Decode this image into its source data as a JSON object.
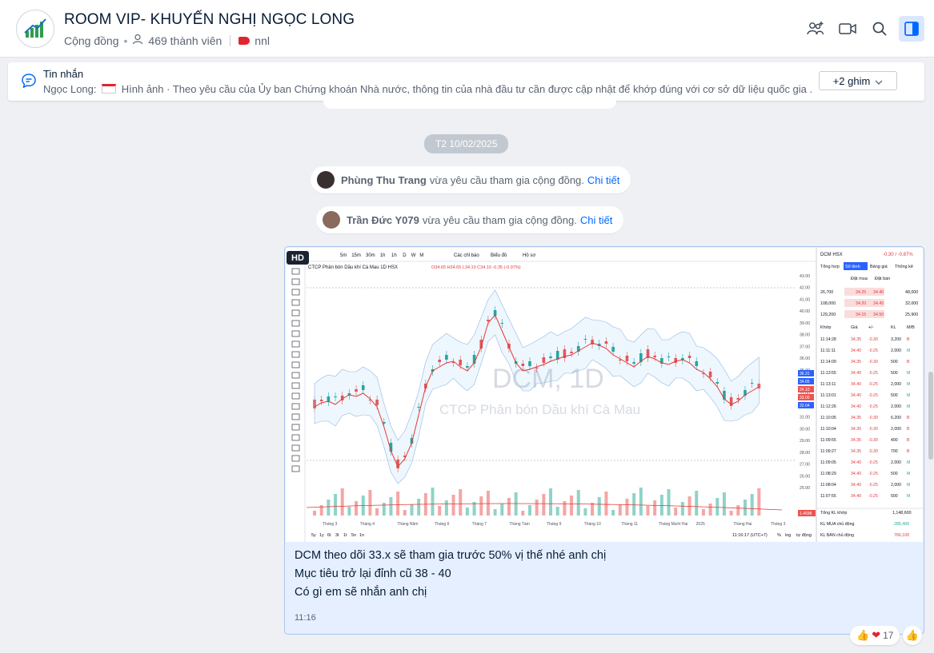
{
  "header": {
    "title": "ROOM VIP- KHUYẾN NGHỊ NGỌC LONG",
    "type_label": "Cộng đồng",
    "members": "469 thành viên",
    "tag": "nnl"
  },
  "pinned": {
    "title": "Tin nhắn",
    "sender": "Ngọc Long:",
    "text": "Hình ảnh · Theo yêu cầu của Ủy ban Chứng khoán Nhà nước, thông tin của nhà đầu tư cần được cập nhật để khớp đúng với cơ sở dữ liệu quốc gia ...",
    "more_button": "+2 ghim"
  },
  "date_pill": "T2 10/02/2025",
  "system_messages": [
    {
      "name": "Phùng Thu Trang",
      "text": "vừa yêu cầu tham gia cộng đồng.",
      "link": "Chi tiết"
    },
    {
      "name": "Trần Đức Y079",
      "text": "vừa yêu cầu tham gia cộng đồng.",
      "link": "Chi tiết"
    }
  ],
  "message": {
    "hd_badge": "HD",
    "lines": [
      "DCM theo dõi 33.x sẽ tham gia trước 50% vị thế nhé anh chị",
      "Mục tiêu trở lại đỉnh cũ 38 - 40",
      "Có gì em sẽ nhắn anh chị"
    ],
    "time": "11:16"
  },
  "reactions": {
    "count": "17"
  },
  "chart": {
    "toolbar_intervals": [
      "5m",
      "15m",
      "30m",
      "1h",
      "1h",
      "D",
      "W",
      "M"
    ],
    "toolbar_items": [
      "Các chỉ báo",
      "Biểu đồ",
      "Hồ sơ"
    ],
    "symbol_line": "CTCP Phân bón Dầu khí Cà Mau  1D  HSX",
    "ohlc": "O34.65  H34.65  L34.10  C34.10  -0.35 (-0.97%)",
    "watermark_symbol": "DCM, 1D",
    "watermark_name": "CTCP Phân bón Dầu khí Cà Mau",
    "y_ticks": [
      "43.00",
      "42.00",
      "41.00",
      "40.00",
      "39.00",
      "38.00",
      "37.00",
      "36.00",
      "35.00",
      "34.00",
      "33.00",
      "32.00",
      "31.00",
      "30.00",
      "29.00",
      "28.00",
      "27.00",
      "26.00",
      "25.00"
    ],
    "x_ticks": [
      "Tháng 3",
      "Tháng 4",
      "Tháng Năm",
      "Tháng 6",
      "Tháng 7",
      "Tháng Tám",
      "Tháng 9",
      "Tháng 10",
      "Tháng 11",
      "Tháng Mười Hai",
      "2025",
      "Tháng Hai",
      "Tháng 3"
    ],
    "ranges": [
      "5y",
      "1y",
      "6t",
      "3t",
      "1t",
      "5n",
      "1n"
    ],
    "clock": "11:16:17 (UTC+7)",
    "bottom_right": [
      "%",
      "log",
      "tự động"
    ],
    "price_tags": [
      "36.31",
      "34.65",
      "34.10",
      "33.00",
      "32.04"
    ],
    "vol_tag": "1.4698"
  },
  "order_panel": {
    "symbol": "DCM HSX",
    "change": "-0.30 / -0.87%",
    "tabs": [
      "Tổng hợp",
      "Sổ lệnh",
      "Bảng giá",
      "Thống kê"
    ],
    "book_headers": [
      "Đặt mua",
      "Đặt bán"
    ],
    "book_rows": [
      [
        "26,700",
        "34.25",
        "34.40",
        "48,000"
      ],
      [
        "108,000",
        "34.20",
        "34.45",
        "32,000"
      ],
      [
        "129,200",
        "34.15",
        "34.50",
        "25,900"
      ]
    ],
    "match_headers": [
      "Khớp",
      "Giá",
      "+/-",
      "KL",
      "M/B"
    ],
    "match_rows": [
      [
        "11:14:28",
        "34.35",
        "-0.30",
        "3,200",
        "B"
      ],
      [
        "11:11:11",
        "34.40",
        "-0.25",
        "2,000",
        "M"
      ],
      [
        "11:14:09",
        "34.35",
        "-0.30",
        "500",
        "B"
      ],
      [
        "11:13:55",
        "34.40",
        "-0.25",
        "500",
        "M"
      ],
      [
        "11:13:11",
        "34.40",
        "-0.25",
        "2,000",
        "M"
      ],
      [
        "11:13:01",
        "34.40",
        "-0.25",
        "500",
        "M"
      ],
      [
        "11:12:26",
        "34.40",
        "-0.25",
        "2,000",
        "M"
      ],
      [
        "11:10:05",
        "34.35",
        "-0.30",
        "6,200",
        "B"
      ],
      [
        "11:10:04",
        "34.30",
        "-0.30",
        "2,000",
        "B"
      ],
      [
        "11:09:55",
        "34.35",
        "-0.30",
        "400",
        "B"
      ],
      [
        "11:09:27",
        "34.35",
        "-0.30",
        "700",
        "B"
      ],
      [
        "11:09:05",
        "34.40",
        "-0.25",
        "2,000",
        "M"
      ],
      [
        "11:08:29",
        "34.40",
        "-0.25",
        "500",
        "M"
      ],
      [
        "11:08:04",
        "34.40",
        "-0.25",
        "2,000",
        "M"
      ],
      [
        "11:07:55",
        "34.40",
        "-0.25",
        "500",
        "M"
      ]
    ],
    "total_label": "Tổng KL khớp",
    "total_value": "1,148,600",
    "buy_label": "KL MUA chủ động",
    "buy_value": "285,400",
    "sell_label": "KL BÁN chủ động",
    "sell_value": "766,100"
  }
}
